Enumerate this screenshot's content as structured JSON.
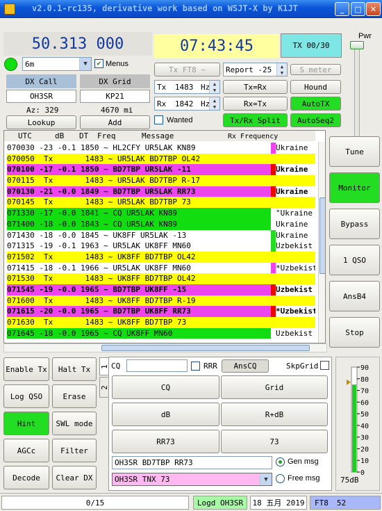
{
  "window": {
    "title": "v2.0.1-rc135, derivative work based on WSJT-X by K1JT",
    "min": "_",
    "max": "□",
    "close": "✕"
  },
  "freq": {
    "dial": "50.313 000",
    "band": "6m",
    "menus_label": "Menus"
  },
  "clock": {
    "time": "07:43:45",
    "tx_count": "TX 00/30"
  },
  "dx": {
    "call_label": "DX Call",
    "grid_label": "DX Grid",
    "call": "OH3SR",
    "grid": "KP21",
    "az": "Az: 329",
    "dist": "4670 mi",
    "lookup": "Lookup",
    "add": "Add"
  },
  "txctrl": {
    "mode_btn": "Tx FT8 ~",
    "report": "Report -25",
    "smeter": "S meter",
    "tx_label": "Tx",
    "tx_val": "1483",
    "rx_label": "Rx",
    "rx_val": "1842",
    "unit": "Hz",
    "txrx": "Tx=Rx",
    "rxtx": "Rx=Tx",
    "hound": "Hound",
    "autotx": "AutoTX",
    "split": "Tx/Rx Split",
    "autoseq": "AutoSeq2",
    "wanted": "Wanted"
  },
  "pwr": {
    "label": "Pwr"
  },
  "decode": {
    "headers": {
      "utc": "UTC",
      "db": "dB",
      "dt": "DT",
      "freq": "Freq",
      "msg": "Message",
      "rxfreq": "Rx Frequency"
    },
    "rows": [
      {
        "t": "070030 -23 -0.1 1850 ~ HL2CFY UR5LAK KN89",
        "c": "Ukraine",
        "bg": "#ffffff",
        "flag": "#ee44ee",
        "bold": false
      },
      {
        "t": "070050  Tx       1483 ~ UR5LAK BD7TBP OL42",
        "c": "",
        "bg": "#ffff00",
        "flag": "",
        "bold": false
      },
      {
        "t": "070100 -17 -0.1 1850 ~ BD7TBP UR5LAK -11",
        "c": "Ukraine",
        "bg": "#ee44ee",
        "flag": "#ee0000",
        "bold": true
      },
      {
        "t": "070115  Tx       1483 ~ UR5LAK BD7TBP R-17",
        "c": "",
        "bg": "#ffff00",
        "flag": "",
        "bold": false
      },
      {
        "t": "070130 -21 -0.0 1849 ~ BD7TBP UR5LAK RR73",
        "c": "Ukraine",
        "bg": "#ee44ee",
        "flag": "#ee0000",
        "bold": true
      },
      {
        "t": "070145  Tx       1483 ~ UR5LAK BD7TBP 73",
        "c": "",
        "bg": "#ffff00",
        "flag": "",
        "bold": false
      },
      {
        "t": "071330 -17 -0.0 1841 ~ CQ UR5LAK KN89",
        "c": "°Ukraine",
        "bg": "#11dd11",
        "flag": "#ffffff",
        "bold": false
      },
      {
        "t": "071400 -18 -0.0 1843 ~ CQ UR5LAK KN89",
        "c": "Ukraine",
        "bg": "#11dd11",
        "flag": "#ffffff",
        "bold": false
      },
      {
        "t": "071430 -18 -0.0 1845 ~ UK8FF UR5LAK -13",
        "c": "Ukraine",
        "bg": "#ffffff",
        "flag": "#22dd22",
        "bold": false
      },
      {
        "t": "071315 -19 -0.1 1963 ~ UR5LAK UK8FF MN60",
        "c": "Uzbekist",
        "bg": "#ffffff",
        "flag": "#22dd22",
        "bold": false
      },
      {
        "t": "071502  Tx       1483 ~ UK8FF BD7TBP OL42",
        "c": "",
        "bg": "#ffff00",
        "flag": "",
        "bold": false
      },
      {
        "t": "071415 -18 -0.1 1966 ~ UR5LAK UK8FF MN60",
        "c": "*Uzbekist",
        "bg": "#ffffff",
        "flag": "#ee44ee",
        "bold": false
      },
      {
        "t": "071530  Tx       1483 ~ UK8FF BD7TBP OL42",
        "c": "",
        "bg": "#ffff00",
        "flag": "",
        "bold": false
      },
      {
        "t": "071545 -19 -0.0 1965 ~ BD7TBP UK8FF -15",
        "c": "Uzbekist",
        "bg": "#ee44ee",
        "flag": "#ee0000",
        "bold": true
      },
      {
        "t": "071600  Tx       1483 ~ UK8FF BD7TBP R-19",
        "c": "",
        "bg": "#ffff00",
        "flag": "",
        "bold": false
      },
      {
        "t": "071615 -20 -0.0 1965 ~ BD7TBP UK8FF RR73",
        "c": "*Uzbekist",
        "bg": "#ee44ee",
        "flag": "#ee0000",
        "bold": true
      },
      {
        "t": "071630  Tx       1483 ~ UK8FF BD7TBP 73",
        "c": "",
        "bg": "#ffff00",
        "flag": "",
        "bold": false
      },
      {
        "t": "071645 -18 -0.0 1965 ~ CQ UK8FF MN60",
        "c": "Uzbekist",
        "bg": "#11dd11",
        "flag": "#ffffff",
        "bold": false
      }
    ]
  },
  "right_buttons": {
    "tune": "Tune",
    "monitor": "Monitor",
    "bypass": "Bypass",
    "qso1": "1 QSO",
    "ansb4": "AnsB4",
    "stop": "Stop"
  },
  "left_buttons": {
    "enable_tx": "Enable Tx",
    "halt_tx": "Halt Tx",
    "log_qso": "Log QSO",
    "erase": "Erase",
    "hint": "Hint",
    "swl": "SWL mode",
    "agcc": "AGCc",
    "filter": "Filter",
    "decode": "Decode",
    "clear_dx": "Clear DX"
  },
  "msgpanel": {
    "tab1": "1",
    "tab2": "2",
    "cq_label": "CQ",
    "rrr": "RRR",
    "anscq": "AnsCQ",
    "skpgrid": "SkpGrid",
    "b_cq": "CQ",
    "b_grid": "Grid",
    "b_db": "dB",
    "b_rdb": "R+dB",
    "b_rr73": "RR73",
    "b_73": "73",
    "gen_msg_text": "OH3SR BD7TBP RR73",
    "free_msg_text": "OH3SR TNX 73",
    "gen_label": "Gen msg",
    "free_label": "Free msg"
  },
  "meter": {
    "ticks": [
      "90",
      "80",
      "70",
      "60",
      "50",
      "40",
      "30",
      "20",
      "10",
      "0"
    ],
    "level_label": "75dB",
    "level_db": 75,
    "peak_db": 77
  },
  "status": {
    "progress": "0/15",
    "logd": "Logd OH3SR",
    "date": "18 五月 2019",
    "mode": "FT8",
    "period": "52"
  }
}
